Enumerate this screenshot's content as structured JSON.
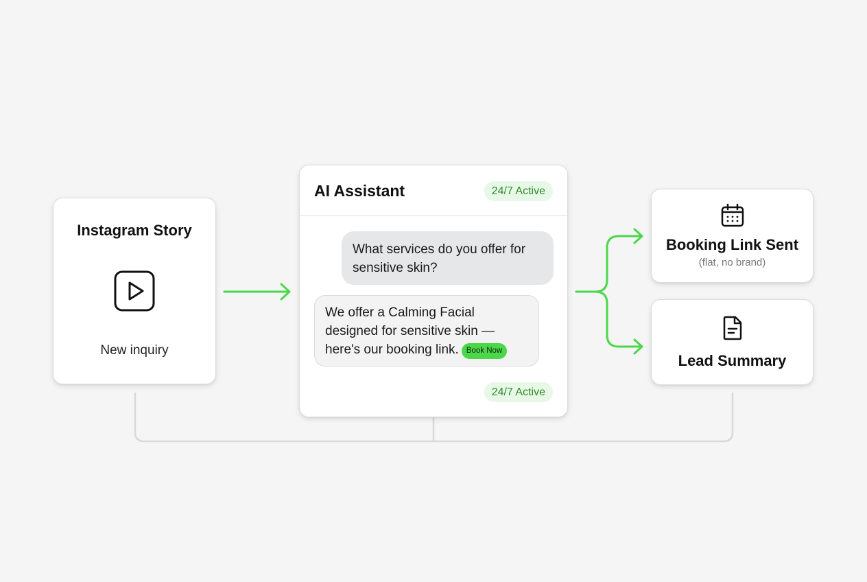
{
  "colors": {
    "background": "#f5f5f5",
    "accent_green": "#4cd74a",
    "badge_bg": "#e8f8e6",
    "badge_text": "#2f8a2b",
    "connector_gray": "#d8d8d8"
  },
  "source_card": {
    "title": "Instagram Story",
    "icon": "play-icon",
    "subtitle": "New inquiry"
  },
  "chat_card": {
    "title": "AI Assistant",
    "status_badge_top": "24/7 Active",
    "status_badge_bottom": "24/7 Active",
    "user_message": {
      "line1": "What services do you offer",
      "line2": "for sensitive skin?"
    },
    "assistant_message": {
      "line1": "We offer a Calming Facial",
      "line2": "designed for sensitive skin —",
      "line3": "here's our booking link.",
      "button_label": "Book Now"
    }
  },
  "outputs": [
    {
      "title": "Booking Link Sent",
      "subtitle": "(flat, no brand)",
      "icon": "calendar-icon"
    },
    {
      "title": "Lead Summary",
      "icon": "document-icon"
    }
  ]
}
